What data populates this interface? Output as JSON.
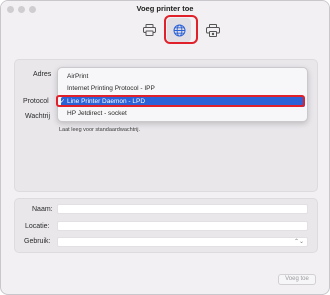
{
  "window": {
    "title": "Voeg printer toe"
  },
  "toolbar": {
    "default_icon": "printer-icon",
    "ip_icon": "globe-icon",
    "windows_icon": "windows-printer-icon"
  },
  "form": {
    "address_label": "Adres",
    "protocol_label": "Protocol",
    "queue_label": "Wachtrij",
    "queue_hint": "Laat leeg voor standaardwachtrij."
  },
  "protocol_menu": {
    "items": [
      "AirPrint",
      "Internet Printing Protocol - IPP",
      "Line Printer Daemon - LPD",
      "HP Jetdirect - socket"
    ],
    "selected_index": 2,
    "check": "✓"
  },
  "details": {
    "name_label": "Naam:",
    "location_label": "Locatie:",
    "use_label": "Gebruik:",
    "use_stepper": "⌃⌄"
  },
  "footer": {
    "add_button": "Voeg toe"
  },
  "colors": {
    "accent": "#2c62d8",
    "highlight": "#e0202a"
  }
}
